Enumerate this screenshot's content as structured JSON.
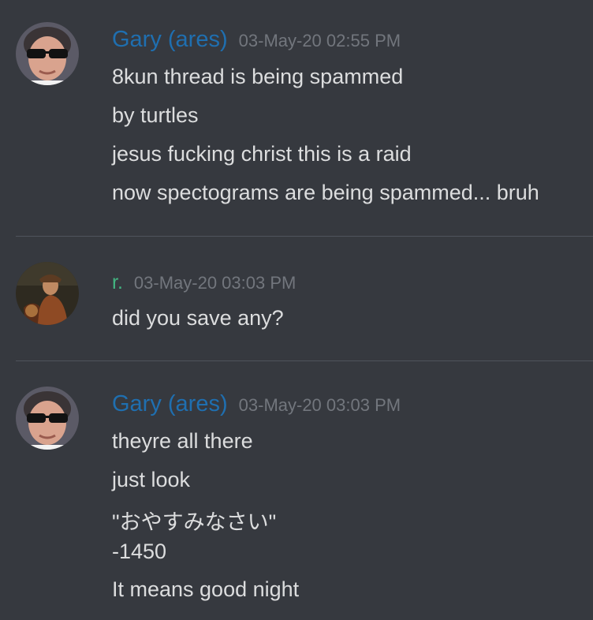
{
  "messages": [
    {
      "author": "Gary (ares)",
      "author_color": "#1f6fb0",
      "avatar_icon": "sunglasses-face-avatar",
      "timestamp": "03-May-20 02:55 PM",
      "lines": [
        "8kun thread is being spammed",
        "by turtles",
        "jesus fucking christ this is a raid",
        "now spectograms are being spammed... bruh"
      ]
    },
    {
      "author": "r.",
      "author_color": "#43b581",
      "avatar_icon": "painting-portrait-avatar",
      "timestamp": "03-May-20 03:03 PM",
      "lines": [
        "did you save any?"
      ]
    },
    {
      "author": "Gary (ares)",
      "author_color": "#1f6fb0",
      "avatar_icon": "sunglasses-face-avatar",
      "timestamp": "03-May-20 03:03 PM",
      "lines": [
        "theyre all there",
        "just look",
        "\"おやすみなさい\"",
        "-1450",
        "It means good night"
      ]
    }
  ]
}
